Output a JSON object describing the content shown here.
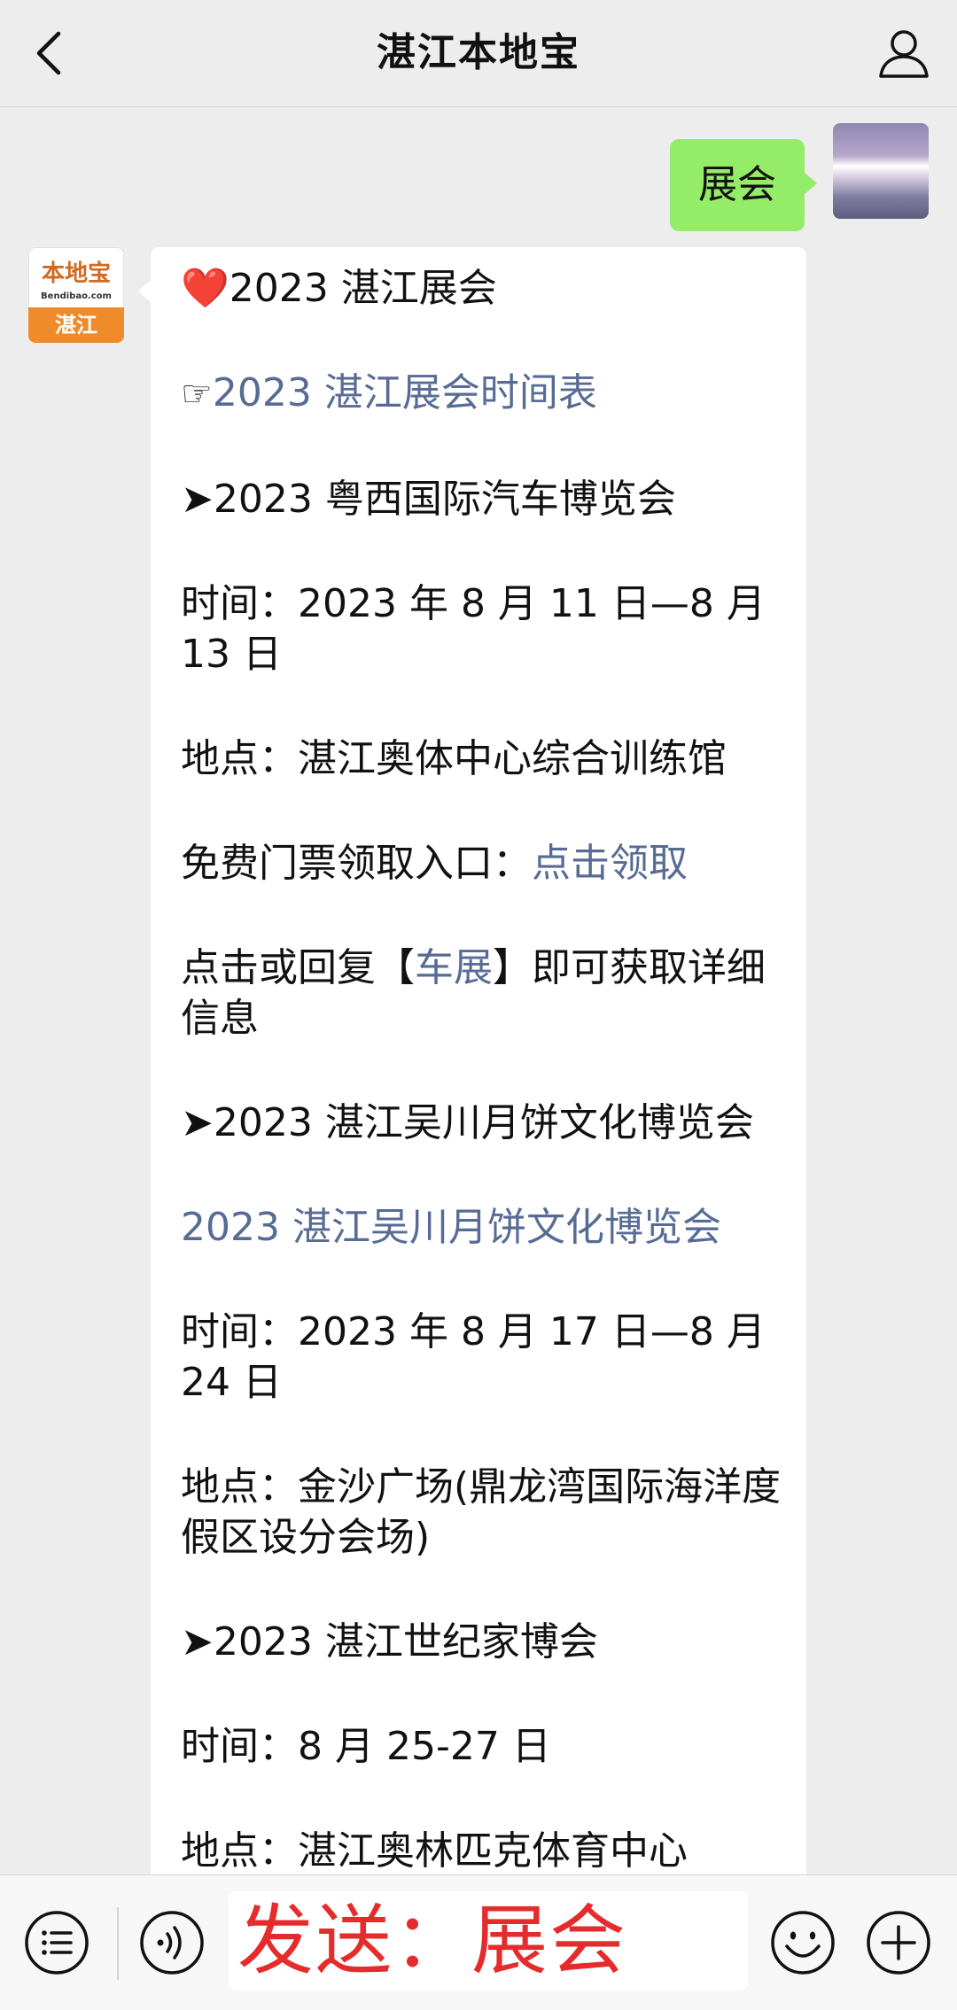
{
  "header": {
    "title": "湛江本地宝",
    "back_icon": "chevron-left-icon",
    "user_icon": "user-icon"
  },
  "outgoing": {
    "text": "展会"
  },
  "sender_logo": {
    "top_text": "本地宝",
    "url_text": "Bendibao.com",
    "bottom_text": "湛江"
  },
  "message": {
    "heart": "❤️",
    "title": "2023 湛江展会",
    "point_hand": "☞",
    "schedule_link": "2023 湛江展会时间表",
    "arrow": "➤",
    "e1_title": "2023 粤西国际汽车博览会",
    "e1_time": "时间：2023 年 8 月 11 日—8 月 13 日",
    "e1_place": "地点：湛江奥体中心综合训练馆",
    "e1_ticket_label": "免费门票领取入口：",
    "e1_ticket_link": "点击领取",
    "e1_reply_prefix": "点击或回复【",
    "e1_reply_link": "车展",
    "e1_reply_suffix": "】即可获取详细信息",
    "e2_title": "2023 湛江吴川月饼文化博览会",
    "e2_link": "2023 湛江吴川月饼文化博览会",
    "e2_time": "时间：2023 年 8 月 17 日—8 月 24 日",
    "e2_place": "地点：金沙广场(鼎龙湾国际海洋度假区设分会场)",
    "e3_title": "2023 湛江世纪家博会",
    "e3_time": "时间：8 月 25-27 日",
    "e3_place": "地点：湛江奥林匹克体育中心"
  },
  "input_bar": {
    "input_text": "发送：展会",
    "icons": [
      "menu-list-icon",
      "voice-icon",
      "emoji-icon",
      "plus-icon"
    ]
  },
  "colors": {
    "link": "#576b95",
    "outgoing_bubble": "#95ec69",
    "overlay_text": "#e52b2b"
  }
}
